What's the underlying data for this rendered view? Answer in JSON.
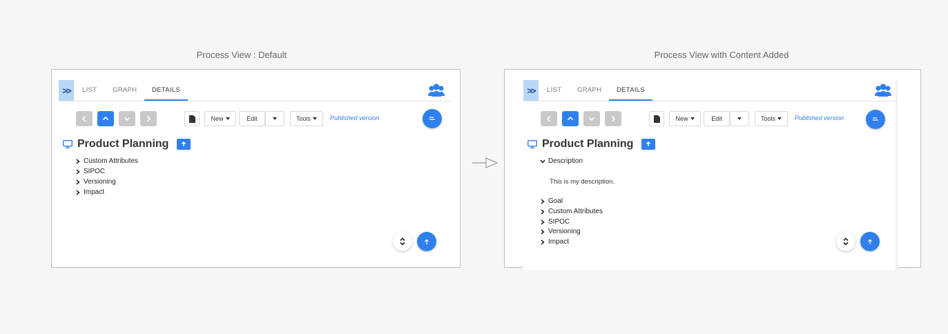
{
  "left": {
    "caption": "Process View : Default",
    "tabs": [
      "LIST",
      "GRAPH",
      "DETAILS"
    ],
    "toolbar": {
      "new": "New",
      "edit": "Edit",
      "tools": "Tools",
      "published": "Published version"
    },
    "title": "Product Planning",
    "sections": [
      "Custom Attributes",
      "SIPOC",
      "Versioning",
      "Impact"
    ]
  },
  "right": {
    "caption": "Process View with Content Added",
    "tabs": [
      "LIST",
      "GRAPH",
      "DETAILS"
    ],
    "toolbar": {
      "new": "New",
      "edit": "Edit",
      "tools": "Tools",
      "published": "Published version"
    },
    "title": "Product Planning",
    "expanded_section": "Description",
    "description_text": "This is my description.",
    "sections": [
      "Goal",
      "Custom Attributes",
      "SIPOC",
      "Versioning",
      "Impact"
    ]
  },
  "colors": {
    "accent": "#2f80ed",
    "expand_bg": "#b9d6f6",
    "nav_disabled": "#c9c9c9"
  },
  "icons": [
    "expand-icon",
    "users-icon",
    "document-icon",
    "monitor-icon",
    "chevron-icon",
    "plus-icon",
    "arrow-up-icon",
    "sort-icon",
    "swap-icon",
    "right-arrow-icon"
  ]
}
